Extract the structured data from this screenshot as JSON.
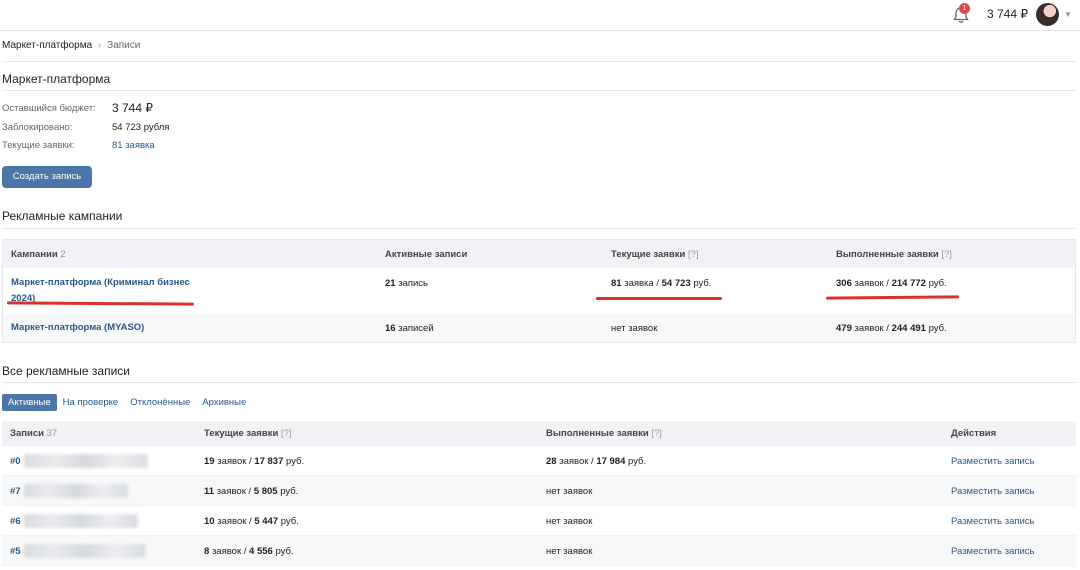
{
  "header": {
    "notification_count": "1",
    "balance": "3 744 ₽"
  },
  "breadcrumb": {
    "root": "Маркет-платформа",
    "separator": "›",
    "current": "Записи"
  },
  "platform": {
    "title": "Маркет-платформа",
    "budget_label": "Оставшийся бюджет:",
    "budget_value": "3 744 ₽",
    "blocked_label": "Заблокировано:",
    "blocked_value": "54 723 рубля",
    "requests_label": "Текущие заявки:",
    "requests_value": "81 заявка",
    "create_button": "Создать запись"
  },
  "campaigns": {
    "title": "Рекламные кампании",
    "headers": {
      "name": "Кампании",
      "name_count": "2",
      "active": "Активные записи",
      "current": "Текущие заявки",
      "current_hint": "[?]",
      "done": "Выполненные заявки",
      "done_hint": "[?]"
    },
    "rows": [
      {
        "name_line1": "Маркет-платформа (Криминал бизнес",
        "name_line2": "2024)",
        "active_count": "21",
        "active_unit": "запись",
        "current_count": "81",
        "current_unit": "заявка /",
        "current_sum": "54 723",
        "current_currency": "руб.",
        "done_count": "306",
        "done_unit": "заявок /",
        "done_sum": "214 772",
        "done_currency": "руб."
      },
      {
        "name": "Маркет-платформа (MYASO)",
        "active_count": "16",
        "active_unit": "записей",
        "current_text": "нет заявок",
        "done_count": "479",
        "done_unit": "заявок /",
        "done_sum": "244 491",
        "done_currency": "руб."
      }
    ]
  },
  "records": {
    "title": "Все рекламные записи",
    "tabs": [
      "Активные",
      "На проверке",
      "Отклонённые",
      "Архивные"
    ],
    "headers": {
      "name": "Записи",
      "name_count": "37",
      "current": "Текущие заявки",
      "current_hint": "[?]",
      "done": "Выполненные заявки",
      "done_hint": "[?]",
      "actions": "Действия"
    },
    "rows": [
      {
        "id": "#0",
        "cur_count": "19",
        "cur_unit": "заявок /",
        "cur_sum": "17 837",
        "cur_cur": "руб.",
        "done_count": "28",
        "done_unit": "заявок /",
        "done_sum": "17 984",
        "done_cur": "руб.",
        "action": "Разместить запись"
      },
      {
        "id": "#7",
        "cur_count": "11",
        "cur_unit": "заявок /",
        "cur_sum": "5 805",
        "cur_cur": "руб.",
        "done_text": "нет заявок",
        "action": "Разместить запись"
      },
      {
        "id": "#6",
        "cur_count": "10",
        "cur_unit": "заявок /",
        "cur_sum": "5 447",
        "cur_cur": "руб.",
        "done_text": "нет заявок",
        "action": "Разместить запись"
      },
      {
        "id": "#5",
        "cur_count": "8",
        "cur_unit": "заявок /",
        "cur_sum": "4 556",
        "cur_cur": "руб.",
        "done_text": "нет заявок",
        "action": "Разместить запись"
      }
    ]
  },
  "colors": {
    "accent": "#4a76a8",
    "link": "#2a5885",
    "highlight": "#d9322b"
  }
}
